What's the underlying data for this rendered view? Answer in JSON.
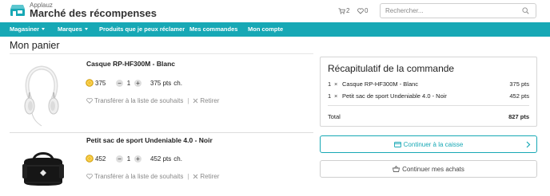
{
  "header": {
    "brand_small": "Applauz",
    "brand_title": "Marché des récompenses",
    "cart_count": "2",
    "wishlist_count": "0",
    "search_placeholder": "Rechercher..."
  },
  "nav": {
    "items": [
      {
        "label": "Magasiner"
      },
      {
        "label": "Marques"
      },
      {
        "label": "Produits que je peux réclamer"
      },
      {
        "label": "Mes commandes"
      },
      {
        "label": "Mon compte"
      }
    ]
  },
  "page_title": "Mon panier",
  "cart": {
    "items": [
      {
        "name": "Casque RP-HF300M - Blanc",
        "points": "375",
        "quantity": "1",
        "line_total": "375 pts",
        "line_total_unit": "ch.",
        "wishlist_label": "Transférer à la liste de souhaits",
        "remove_label": "Retirer"
      },
      {
        "name": "Petit sac de sport Undeniable 4.0 - Noir",
        "points": "452",
        "quantity": "1",
        "line_total": "452 pts",
        "line_total_unit": "ch.",
        "wishlist_label": "Transférer à la liste de souhaits",
        "remove_label": "Retirer"
      }
    ],
    "minus": "−",
    "plus": "+",
    "separator": "|"
  },
  "summary": {
    "title": "Récapitulatif de la commande",
    "times": "×",
    "rows": [
      {
        "qty": "1",
        "name": "Casque RP-HF300M - Blanc",
        "pts": "375 pts"
      },
      {
        "qty": "1",
        "name": "Petit sac de sport Undeniable 4.0 - Noir",
        "pts": "452 pts"
      }
    ],
    "total_label": "Total",
    "total_value": "827 pts"
  },
  "buttons": {
    "checkout": "Continuer à la caisse",
    "continue_shopping": "Continuer mes achats"
  },
  "icons": {
    "logo": "store-icon",
    "cart": "cart-icon",
    "wishlist": "heart-icon",
    "search": "search-icon",
    "coin": "points-coin-icon",
    "checkout": "credit-card-icon",
    "continue": "shopping-basket-icon"
  },
  "colors": {
    "accent": "#17a8b5",
    "nav_bg": "#17a8b5",
    "text": "#222222",
    "muted": "#888888"
  }
}
